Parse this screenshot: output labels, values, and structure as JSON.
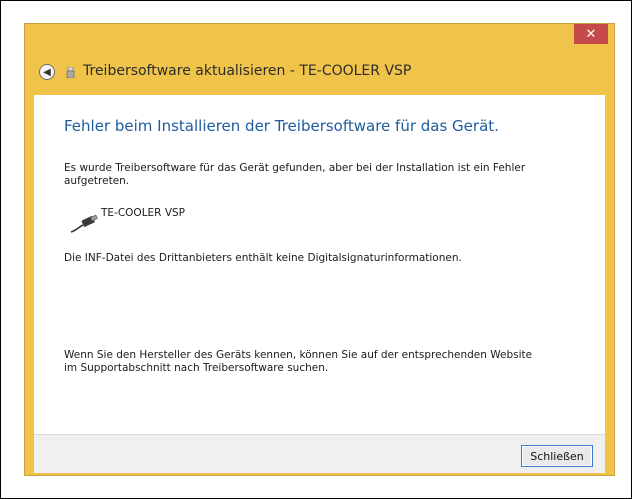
{
  "window": {
    "title": "Treibersoftware aktualisieren - TE-COOLER VSP",
    "close_glyph": "✕"
  },
  "content": {
    "heading": "Fehler beim Installieren der Treibersoftware für das Gerät.",
    "message": "Es wurde Treibersoftware für das Gerät gefunden, aber bei der Installation ist ein Fehler aufgetreten.",
    "device_name": "TE-COOLER VSP",
    "error_detail": "Die INF-Datei des Drittanbieters enthält keine Digitalsignaturinformationen.",
    "hint": "Wenn Sie den Hersteller des Geräts kennen, können Sie auf der entsprechenden Website im Supportabschnitt nach Treibersoftware suchen."
  },
  "footer": {
    "close_label": "Schließen"
  },
  "icons": {
    "back": "back-arrow-icon",
    "title": "usb-device-icon",
    "device": "usb-cable-icon"
  },
  "colors": {
    "titlebar": "#f0c44a",
    "close": "#c74a4a",
    "heading": "#1f5b9e"
  }
}
